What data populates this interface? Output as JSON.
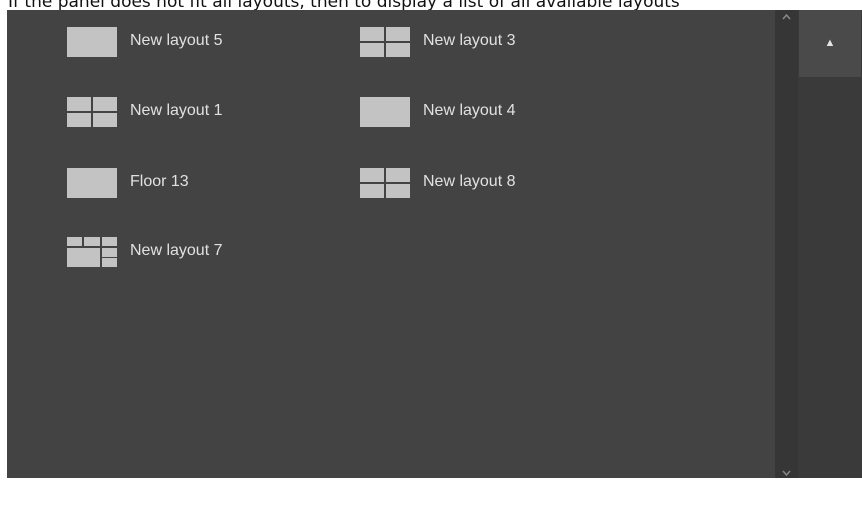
{
  "caption": "If the panel does not fit all layouts, then to display a list of all available layouts",
  "layouts": [
    {
      "label": "New layout 5",
      "icon": "layout-single-icon"
    },
    {
      "label": "New layout 3",
      "icon": "layout-grid-2x2-icon"
    },
    {
      "label": "New layout 1",
      "icon": "layout-grid-2x2-icon"
    },
    {
      "label": "New layout 4",
      "icon": "layout-single-icon"
    },
    {
      "label": "Floor 13",
      "icon": "layout-single-icon"
    },
    {
      "label": "New layout 8",
      "icon": "layout-grid-2x2-icon"
    },
    {
      "label": "New layout 7",
      "icon": "layout-grid-mixed-icon"
    }
  ],
  "scrollbar": {
    "up_glyph": "^",
    "down_glyph": "v"
  },
  "sidebar": {
    "up_button_glyph": "▲"
  },
  "colors": {
    "panel": "#434343",
    "icon": "#c3c3c3",
    "text": "#e1e1e1"
  }
}
